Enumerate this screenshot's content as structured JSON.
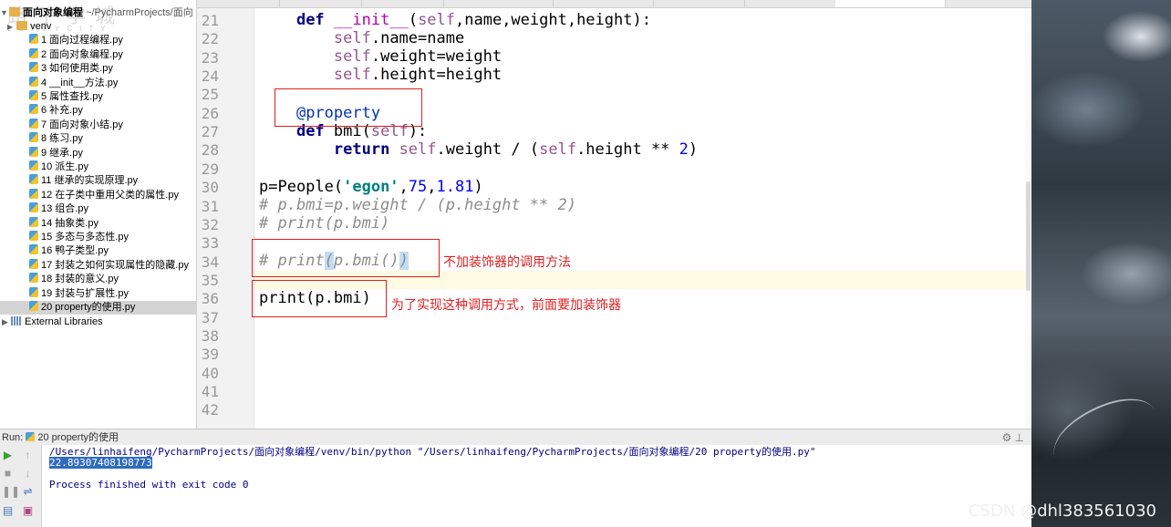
{
  "tree": {
    "root_project": "面向对象编程",
    "root_path": "~/PycharmProjects/面向",
    "items": [
      {
        "label": "venv",
        "type": "folder"
      },
      {
        "label": "1 面向过程编程.py",
        "type": "file"
      },
      {
        "label": "2 面向对象编程.py",
        "type": "file"
      },
      {
        "label": "3 如何使用类.py",
        "type": "file"
      },
      {
        "label": "4 __init__方法.py",
        "type": "file"
      },
      {
        "label": "5 属性查找.py",
        "type": "file"
      },
      {
        "label": "6 补充.py",
        "type": "file"
      },
      {
        "label": "7 面向对象小结.py",
        "type": "file"
      },
      {
        "label": "8 练习.py",
        "type": "file"
      },
      {
        "label": "9 继承.py",
        "type": "file"
      },
      {
        "label": "10 派生.py",
        "type": "file"
      },
      {
        "label": "11 继承的实现原理.py",
        "type": "file"
      },
      {
        "label": "12 在子类中重用父类的属性.py",
        "type": "file"
      },
      {
        "label": "13 组合.py",
        "type": "file"
      },
      {
        "label": "14 抽象类.py",
        "type": "file"
      },
      {
        "label": "15 多态与多态性.py",
        "type": "file"
      },
      {
        "label": "16 鸭子类型.py",
        "type": "file"
      },
      {
        "label": "17 封装之如何实现属性的隐藏.py",
        "type": "file"
      },
      {
        "label": "18 封装的意义.py",
        "type": "file"
      },
      {
        "label": "19 封装与扩展性.py",
        "type": "file"
      },
      {
        "label": "20 property的使用.py",
        "type": "file",
        "selected": true
      }
    ],
    "external_libraries": "External Libraries"
  },
  "editor": {
    "line_numbers": [
      "21",
      "22",
      "23",
      "24",
      "25",
      "26",
      "27",
      "28",
      "29",
      "30",
      "31",
      "32",
      "33",
      "34",
      "35",
      "36",
      "37",
      "38",
      "39",
      "40",
      "41",
      "42"
    ],
    "annotations": {
      "no_decorator": "不加装饰器的调用方法",
      "with_decorator": "为了实现这种调用方式，前面要加装饰器"
    }
  },
  "run": {
    "title": "Run",
    "config": "20 property的使用",
    "command": "/Users/linhaifeng/PycharmProjects/面向对象编程/venv/bin/python \"/Users/linhaifeng/PycharmProjects/面向对象编程/20 property的使用.py\"",
    "output": "22.89307408198773",
    "exit_message": "Process finished with exit code 0"
  },
  "watermark": "CSDN @dhl383561030",
  "colors": {
    "keyword": "#000080",
    "self": "#94558d",
    "string": "#008080",
    "number": "#0000ff",
    "comment": "#8c8c8c",
    "annotation_red": "#e02020",
    "selection": "#d4d4d4"
  }
}
